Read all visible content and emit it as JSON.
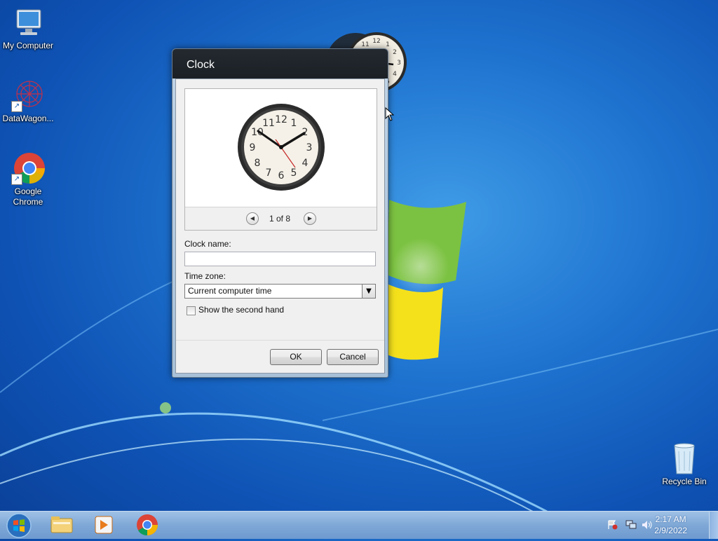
{
  "desktop": {
    "icons": [
      {
        "label": "My Computer"
      },
      {
        "label": "DataWagon..."
      },
      {
        "label": "Google Chrome"
      },
      {
        "label": "Recycle Bin"
      }
    ]
  },
  "dialog": {
    "title": "Clock",
    "preview": {
      "page_indicator": "1 of 8"
    },
    "clock_name_label": "Clock name:",
    "clock_name_value": "",
    "time_zone_label": "Time zone:",
    "time_zone_value": "Current computer time",
    "second_hand_label": "Show the second hand",
    "second_hand_checked": false,
    "ok_label": "OK",
    "cancel_label": "Cancel"
  },
  "taskbar": {
    "time": "2:17 AM",
    "date": "2/9/2022"
  },
  "colors": {
    "desktop_blue": "#1f74d0",
    "dialog_title_bg": "#1b2025",
    "taskbar": "#7fa8d6"
  }
}
